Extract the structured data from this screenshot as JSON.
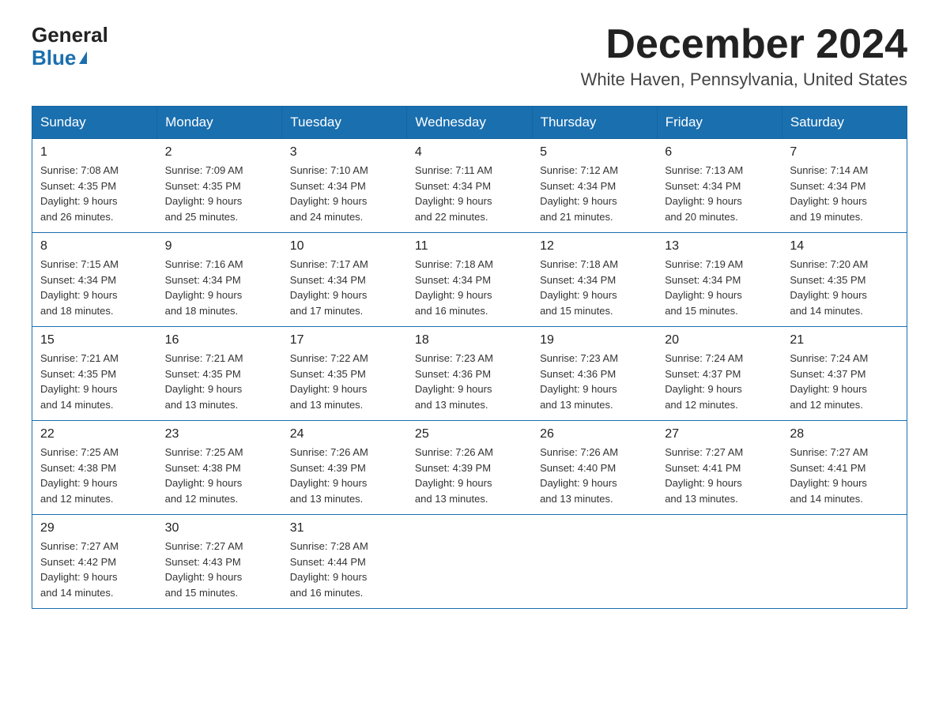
{
  "logo": {
    "general": "General",
    "blue": "Blue"
  },
  "header": {
    "month": "December 2024",
    "location": "White Haven, Pennsylvania, United States"
  },
  "weekdays": [
    "Sunday",
    "Monday",
    "Tuesday",
    "Wednesday",
    "Thursday",
    "Friday",
    "Saturday"
  ],
  "weeks": [
    [
      {
        "day": "1",
        "sunrise": "7:08 AM",
        "sunset": "4:35 PM",
        "daylight": "9 hours and 26 minutes."
      },
      {
        "day": "2",
        "sunrise": "7:09 AM",
        "sunset": "4:35 PM",
        "daylight": "9 hours and 25 minutes."
      },
      {
        "day": "3",
        "sunrise": "7:10 AM",
        "sunset": "4:34 PM",
        "daylight": "9 hours and 24 minutes."
      },
      {
        "day": "4",
        "sunrise": "7:11 AM",
        "sunset": "4:34 PM",
        "daylight": "9 hours and 22 minutes."
      },
      {
        "day": "5",
        "sunrise": "7:12 AM",
        "sunset": "4:34 PM",
        "daylight": "9 hours and 21 minutes."
      },
      {
        "day": "6",
        "sunrise": "7:13 AM",
        "sunset": "4:34 PM",
        "daylight": "9 hours and 20 minutes."
      },
      {
        "day": "7",
        "sunrise": "7:14 AM",
        "sunset": "4:34 PM",
        "daylight": "9 hours and 19 minutes."
      }
    ],
    [
      {
        "day": "8",
        "sunrise": "7:15 AM",
        "sunset": "4:34 PM",
        "daylight": "9 hours and 18 minutes."
      },
      {
        "day": "9",
        "sunrise": "7:16 AM",
        "sunset": "4:34 PM",
        "daylight": "9 hours and 18 minutes."
      },
      {
        "day": "10",
        "sunrise": "7:17 AM",
        "sunset": "4:34 PM",
        "daylight": "9 hours and 17 minutes."
      },
      {
        "day": "11",
        "sunrise": "7:18 AM",
        "sunset": "4:34 PM",
        "daylight": "9 hours and 16 minutes."
      },
      {
        "day": "12",
        "sunrise": "7:18 AM",
        "sunset": "4:34 PM",
        "daylight": "9 hours and 15 minutes."
      },
      {
        "day": "13",
        "sunrise": "7:19 AM",
        "sunset": "4:34 PM",
        "daylight": "9 hours and 15 minutes."
      },
      {
        "day": "14",
        "sunrise": "7:20 AM",
        "sunset": "4:35 PM",
        "daylight": "9 hours and 14 minutes."
      }
    ],
    [
      {
        "day": "15",
        "sunrise": "7:21 AM",
        "sunset": "4:35 PM",
        "daylight": "9 hours and 14 minutes."
      },
      {
        "day": "16",
        "sunrise": "7:21 AM",
        "sunset": "4:35 PM",
        "daylight": "9 hours and 13 minutes."
      },
      {
        "day": "17",
        "sunrise": "7:22 AM",
        "sunset": "4:35 PM",
        "daylight": "9 hours and 13 minutes."
      },
      {
        "day": "18",
        "sunrise": "7:23 AM",
        "sunset": "4:36 PM",
        "daylight": "9 hours and 13 minutes."
      },
      {
        "day": "19",
        "sunrise": "7:23 AM",
        "sunset": "4:36 PM",
        "daylight": "9 hours and 13 minutes."
      },
      {
        "day": "20",
        "sunrise": "7:24 AM",
        "sunset": "4:37 PM",
        "daylight": "9 hours and 12 minutes."
      },
      {
        "day": "21",
        "sunrise": "7:24 AM",
        "sunset": "4:37 PM",
        "daylight": "9 hours and 12 minutes."
      }
    ],
    [
      {
        "day": "22",
        "sunrise": "7:25 AM",
        "sunset": "4:38 PM",
        "daylight": "9 hours and 12 minutes."
      },
      {
        "day": "23",
        "sunrise": "7:25 AM",
        "sunset": "4:38 PM",
        "daylight": "9 hours and 12 minutes."
      },
      {
        "day": "24",
        "sunrise": "7:26 AM",
        "sunset": "4:39 PM",
        "daylight": "9 hours and 13 minutes."
      },
      {
        "day": "25",
        "sunrise": "7:26 AM",
        "sunset": "4:39 PM",
        "daylight": "9 hours and 13 minutes."
      },
      {
        "day": "26",
        "sunrise": "7:26 AM",
        "sunset": "4:40 PM",
        "daylight": "9 hours and 13 minutes."
      },
      {
        "day": "27",
        "sunrise": "7:27 AM",
        "sunset": "4:41 PM",
        "daylight": "9 hours and 13 minutes."
      },
      {
        "day": "28",
        "sunrise": "7:27 AM",
        "sunset": "4:41 PM",
        "daylight": "9 hours and 14 minutes."
      }
    ],
    [
      {
        "day": "29",
        "sunrise": "7:27 AM",
        "sunset": "4:42 PM",
        "daylight": "9 hours and 14 minutes."
      },
      {
        "day": "30",
        "sunrise": "7:27 AM",
        "sunset": "4:43 PM",
        "daylight": "9 hours and 15 minutes."
      },
      {
        "day": "31",
        "sunrise": "7:28 AM",
        "sunset": "4:44 PM",
        "daylight": "9 hours and 16 minutes."
      },
      null,
      null,
      null,
      null
    ]
  ],
  "labels": {
    "sunrise": "Sunrise: ",
    "sunset": "Sunset: ",
    "daylight": "Daylight: "
  }
}
